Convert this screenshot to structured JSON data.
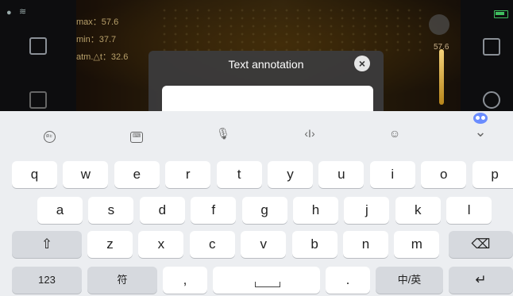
{
  "camera": {
    "max_label": "max：57.6",
    "min_label": "min：37.7",
    "atm_label": "atm.△t：32.6",
    "scale_value": "57.6"
  },
  "dialog": {
    "title": "Text annotation",
    "close_glyph": "×",
    "input_value": ""
  },
  "keyboard_toolbar": {
    "handwriting_glyph": "ตะ",
    "layout_glyph": "⌨",
    "mic_glyph": "🎙",
    "cursor_glyph": "‹I›",
    "emoji_glyph": "☺",
    "collapse_glyph": "⌄"
  },
  "keyboard": {
    "row1": [
      "q",
      "w",
      "e",
      "r",
      "t",
      "y",
      "u",
      "i",
      "o",
      "p"
    ],
    "row2": [
      "a",
      "s",
      "d",
      "f",
      "g",
      "h",
      "j",
      "k",
      "l"
    ],
    "row3": [
      "z",
      "x",
      "c",
      "v",
      "b",
      "n",
      "m"
    ],
    "shift_glyph": "⇧",
    "backspace_glyph": "⌫",
    "numbers_label": "123",
    "symbols_label": "符",
    "comma_label": ",",
    "period_label": ".",
    "lang_label": "中/英",
    "enter_glyph": "↵"
  },
  "colors": {
    "accent_readout": "#b8a06a",
    "keyboard_bg": "#eceef1",
    "battery_green": "#3fbf5f"
  }
}
